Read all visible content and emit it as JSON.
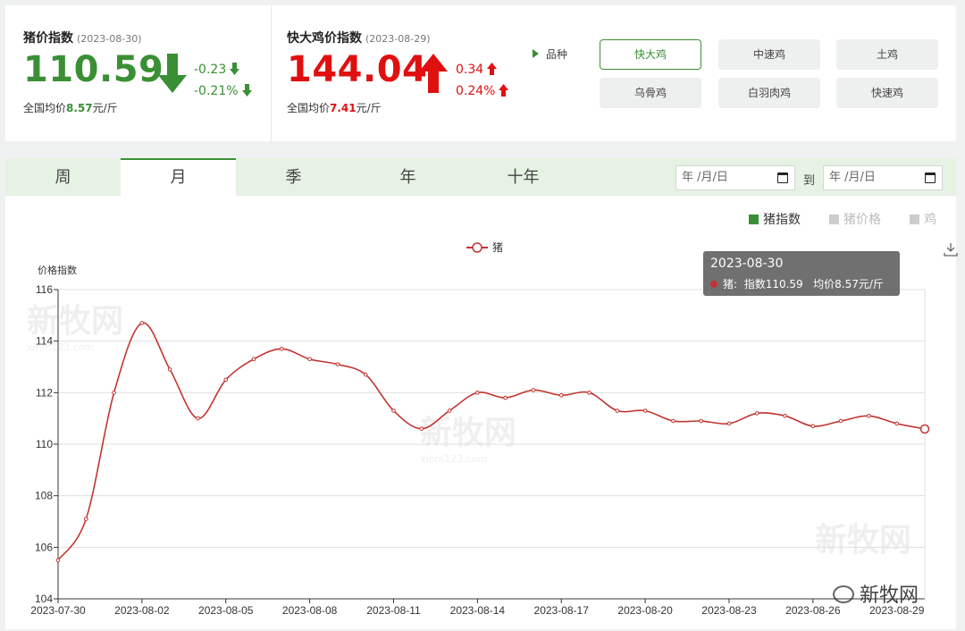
{
  "pig": {
    "title": "猪价指数",
    "date": "(2023-08-30)",
    "value": "110.59",
    "change_abs": "-0.23",
    "change_pct": "-0.21%",
    "avg_label": "全国均价",
    "avg_value": "8.57",
    "avg_unit": "元/斤",
    "color": "#3a8f34"
  },
  "chicken": {
    "title": "快大鸡价指数",
    "date": "(2023-08-29)",
    "value": "144.04",
    "change_abs": "0.34",
    "change_pct": "0.24%",
    "avg_label": "全国均价",
    "avg_value": "7.41",
    "avg_unit": "元/斤",
    "color": "#e01010"
  },
  "variety": {
    "label": "品种",
    "options": [
      "快大鸡",
      "中速鸡",
      "土鸡",
      "乌骨鸡",
      "白羽肉鸡",
      "快速鸡"
    ],
    "selected": "快大鸡"
  },
  "tabs": [
    "周",
    "月",
    "季",
    "年",
    "十年"
  ],
  "active_tab": "月",
  "date_range": {
    "start_placeholder": "年 /月/日",
    "separator": "到",
    "end_placeholder": "年 /月/日"
  },
  "series_toggle": [
    {
      "label": "猪指数",
      "active": true,
      "color": "#3a8f34"
    },
    {
      "label": "猪价格",
      "active": false,
      "color": "#cccccc"
    },
    {
      "label": "鸡",
      "active": false,
      "color": "#cccccc"
    }
  ],
  "watermark": "新牧网",
  "watermark_sub": "xinm123.com",
  "tooltip": {
    "date": "2023-08-30",
    "series": "猪:",
    "index_text": "指数110.59",
    "avg_text": "均价8.57元/斤"
  },
  "chart_data": {
    "type": "line",
    "ylabel": "价格指数",
    "legend": "猪",
    "ylim": [
      104,
      116
    ],
    "yticks": [
      104,
      106,
      108,
      110,
      112,
      114,
      116
    ],
    "xtick_labels": [
      "2023-07-30",
      "2023-08-02",
      "2023-08-05",
      "2023-08-08",
      "2023-08-11",
      "2023-08-14",
      "2023-08-17",
      "2023-08-20",
      "2023-08-23",
      "2023-08-26",
      "2023-08-29"
    ],
    "x": [
      "2023-07-30",
      "2023-07-31",
      "2023-08-01",
      "2023-08-02",
      "2023-08-03",
      "2023-08-04",
      "2023-08-05",
      "2023-08-06",
      "2023-08-07",
      "2023-08-08",
      "2023-08-09",
      "2023-08-10",
      "2023-08-11",
      "2023-08-12",
      "2023-08-13",
      "2023-08-14",
      "2023-08-15",
      "2023-08-16",
      "2023-08-17",
      "2023-08-18",
      "2023-08-19",
      "2023-08-20",
      "2023-08-21",
      "2023-08-22",
      "2023-08-23",
      "2023-08-24",
      "2023-08-25",
      "2023-08-26",
      "2023-08-27",
      "2023-08-28",
      "2023-08-29",
      "2023-08-30"
    ],
    "series": [
      {
        "name": "猪",
        "color": "#c23531",
        "values": [
          105.5,
          107.1,
          112.0,
          114.7,
          112.9,
          111.0,
          112.5,
          113.3,
          113.7,
          113.3,
          113.1,
          112.7,
          111.3,
          110.6,
          111.3,
          112.0,
          111.8,
          112.1,
          111.9,
          112.0,
          111.3,
          111.3,
          110.9,
          110.9,
          110.8,
          111.2,
          111.1,
          110.7,
          110.9,
          111.1,
          110.8,
          110.59
        ]
      }
    ],
    "grid": true,
    "legend_position": "top-center"
  }
}
